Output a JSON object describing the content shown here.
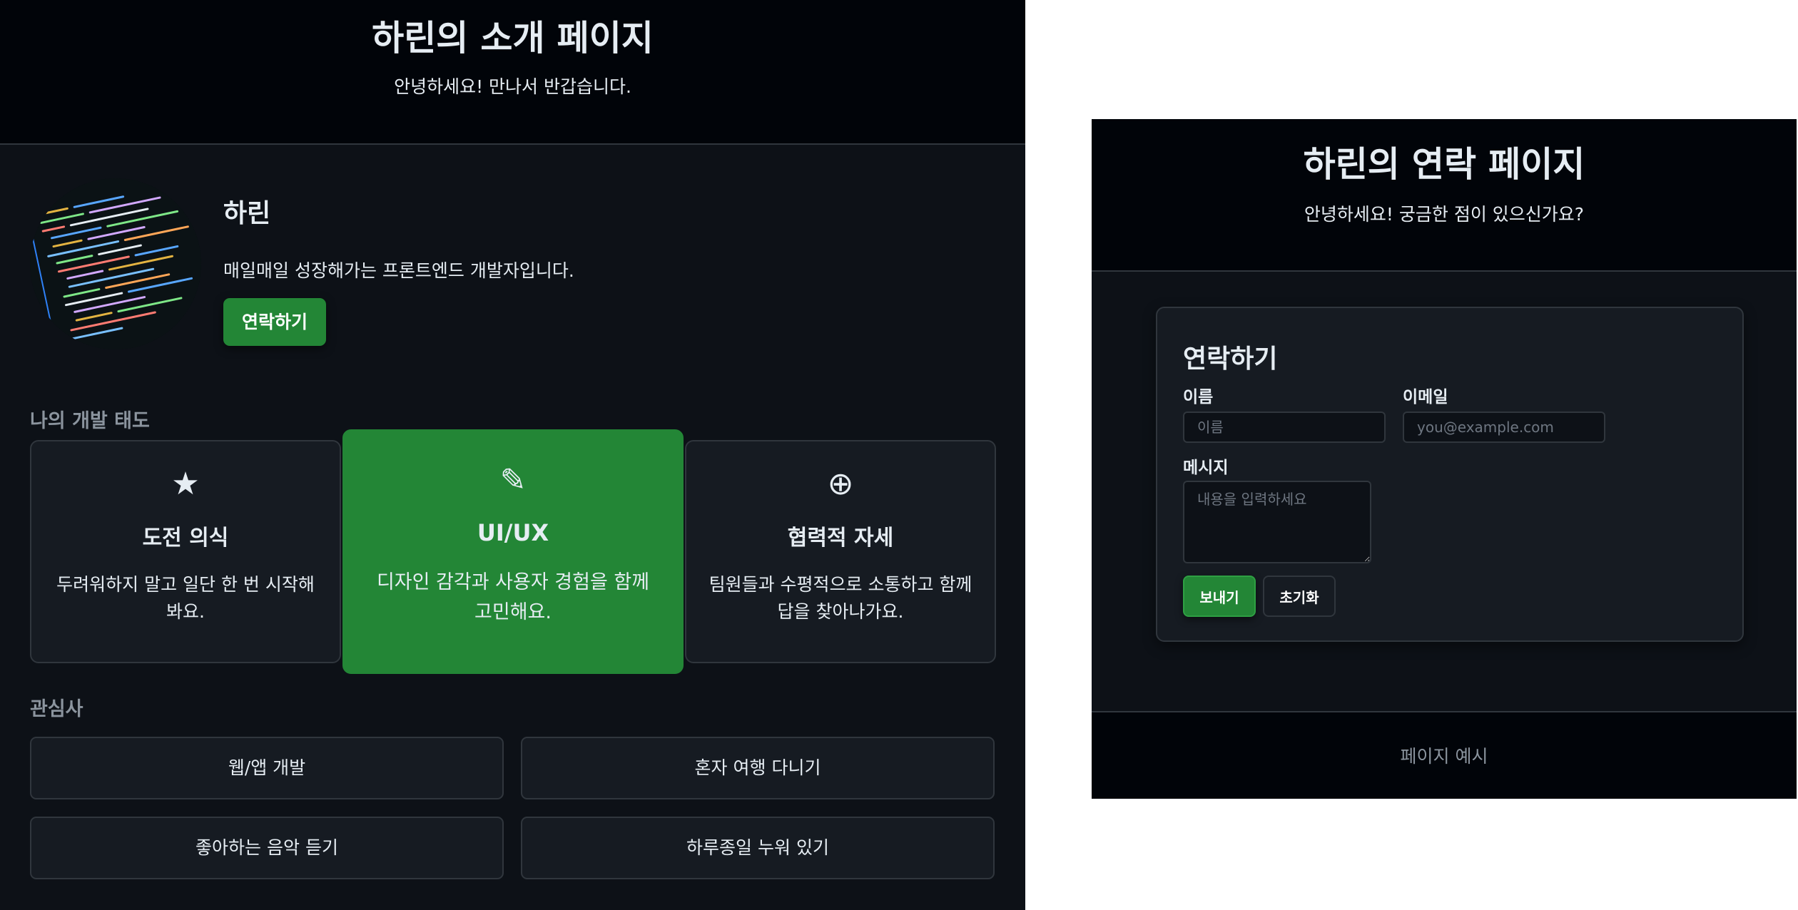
{
  "intro": {
    "title": "하린의 소개 페이지",
    "subtitle": "안녕하세요! 만나서 반갑습니다.",
    "profile": {
      "name": "하린",
      "description": "매일매일 성장해가는 프론트엔드 개발자입니다.",
      "contact_button": "연락하기"
    },
    "attitude": {
      "heading": "나의 개발 태도",
      "cards": [
        {
          "icon": "★",
          "icon_name": "star-icon",
          "title": "도전 의식",
          "text": "두려워하지 말고 일단 한 번 시작해봐요."
        },
        {
          "icon": "✎",
          "icon_name": "pencil-icon",
          "title": "UI/UX",
          "text": "디자인 감각과 사용자 경험을 함께 고민해요."
        },
        {
          "icon": "⊕",
          "icon_name": "circled-plus-icon",
          "title": "협력적 자세",
          "text": "팀원들과 수평적으로 소통하고 함께 답을 찾아나가요."
        }
      ]
    },
    "interests": {
      "heading": "관심사",
      "items": [
        "웹/앱 개발",
        "혼자 여행 다니기",
        "좋아하는 음악 듣기",
        "하루종일 누워 있기"
      ]
    }
  },
  "contact": {
    "title": "하린의 연락 페이지",
    "subtitle": "안녕하세요! 궁금한 점이 있으신가요?",
    "form": {
      "heading": "연락하기",
      "name_label": "이름",
      "name_placeholder": "이름",
      "email_label": "이메일",
      "email_placeholder": "you@example.com",
      "message_label": "메시지",
      "message_placeholder": "내용을 입력하세요",
      "submit": "보내기",
      "reset": "초기화"
    },
    "footer": "페이지 예시"
  },
  "colors": {
    "accent": "#238636",
    "page_bg": "#0d1117",
    "header_bg": "#010409",
    "card_bg": "#161b22",
    "border": "#30363d"
  }
}
